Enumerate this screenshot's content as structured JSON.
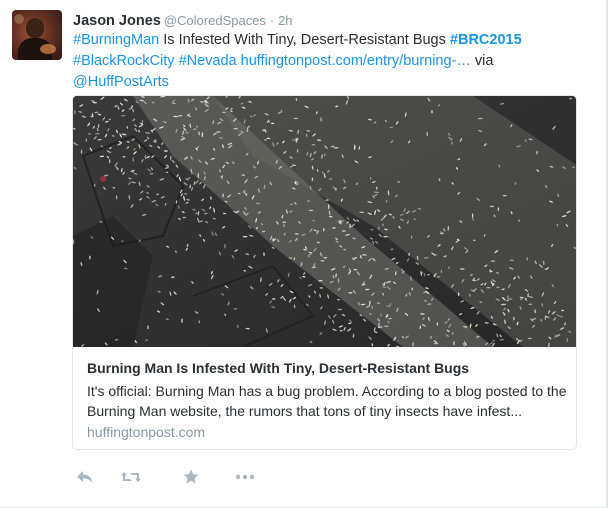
{
  "tweet": {
    "author": {
      "name": "Jason Jones",
      "handle": "@ColoredSpaces",
      "separator": "·",
      "time": "2h"
    },
    "text": {
      "part_1_link": "#BurningMan",
      "part_2": " Is Infested With Tiny, Desert-Resistant Bugs ",
      "part_3_link": "#BRC2015",
      "part_4_link": "#BlackRockCity",
      "part_5_link": "#Nevada",
      "part_6_link": "huffingtonpost.com/entry/burning-…",
      "part_7": " via ",
      "part_8_link": "@HuffPostArts"
    },
    "card": {
      "title": "Burning Man Is Infested With Tiny, Desert-Resistant Bugs",
      "description": "It's official: Burning Man has a bug problem. According to a blog posted to the Burning Man website, the rumors that tons of tiny insects have infest...",
      "domain": "huffingtonpost.com"
    },
    "actions": {
      "reply_icon": "reply-icon",
      "retweet_icon": "retweet-icon",
      "favorite_icon": "star-icon",
      "more_icon": "more-icon"
    }
  },
  "colors": {
    "link": "#1b95e0",
    "muted": "#8899a6",
    "text": "#292f33",
    "border": "#e1e8ed"
  }
}
